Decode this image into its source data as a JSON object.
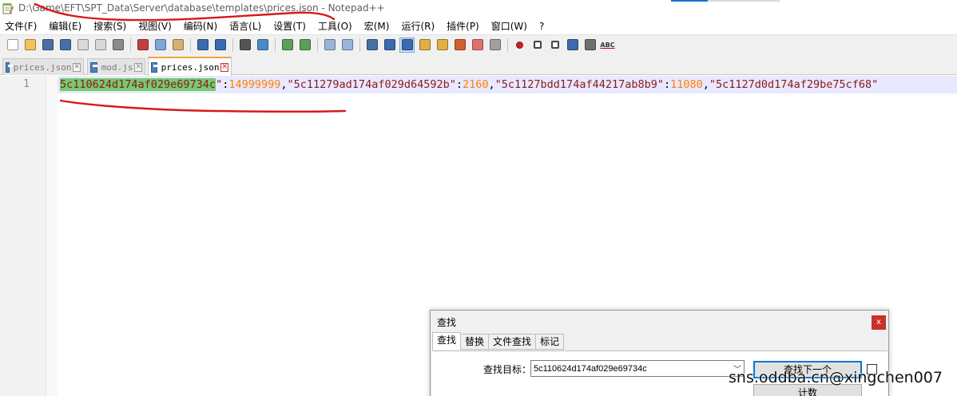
{
  "window": {
    "title": "D:\\Game\\EFT\\SPT_Data\\Server\\database\\templates\\prices.json - Notepad++",
    "app_icon": "notepad-icon"
  },
  "menu": [
    "文件(F)",
    "编辑(E)",
    "搜索(S)",
    "视图(V)",
    "编码(N)",
    "语言(L)",
    "设置(T)",
    "工具(O)",
    "宏(M)",
    "运行(R)",
    "插件(P)",
    "窗口(W)",
    "?"
  ],
  "toolbar": {
    "icons": [
      "new-file-icon",
      "open-file-icon",
      "save-icon",
      "save-all-icon",
      "close-icon",
      "close-all-icon",
      "print-icon",
      "cut-icon",
      "copy-icon",
      "paste-icon",
      "undo-icon",
      "redo-icon",
      "find-icon",
      "replace-icon",
      "zoom-in-icon",
      "zoom-out-icon",
      "sync-vertical-icon",
      "sync-horizontal-icon",
      "word-wrap-icon",
      "show-all-chars-icon",
      "indent-guide-icon",
      "udl-icon",
      "doc-map-icon",
      "function-list-icon",
      "folder-workspace-icon",
      "monitor-icon",
      "record-macro-icon",
      "stop-record-icon",
      "play-macro-icon",
      "run-macro-multiple-icon",
      "save-macro-icon",
      "spell-check-icon"
    ],
    "spellcheck_label": "ABC"
  },
  "tabs": [
    {
      "name": "prices.json",
      "active": false
    },
    {
      "name": "mod.js",
      "active": false
    },
    {
      "name": "prices.json",
      "active": true
    }
  ],
  "tab_close_glyph": "✕",
  "editor": {
    "line_number": "1",
    "tokens": [
      {
        "type": "sel",
        "text": "5c110624d174af029e69734c"
      },
      {
        "type": "str",
        "text": "\""
      },
      {
        "type": "pun",
        "text": ":"
      },
      {
        "type": "num",
        "text": "14999999"
      },
      {
        "type": "pun",
        "text": ","
      },
      {
        "type": "str",
        "text": "\"5c11279ad174af029d64592b\""
      },
      {
        "type": "pun",
        "text": ":"
      },
      {
        "type": "num",
        "text": "2160"
      },
      {
        "type": "pun",
        "text": ","
      },
      {
        "type": "str",
        "text": "\"5c1127bdd174af44217ab8b9\""
      },
      {
        "type": "pun",
        "text": ":"
      },
      {
        "type": "num",
        "text": "11080"
      },
      {
        "type": "pun",
        "text": ","
      },
      {
        "type": "str",
        "text": "\"5c1127d0d174af29be75cf68\""
      }
    ]
  },
  "find_dialog": {
    "title": "查找",
    "close_glyph": "x",
    "tabs": [
      "查找",
      "替换",
      "文件查找",
      "标记"
    ],
    "find_label": "查找目标：",
    "find_value": "5c110624d174af029e69734c",
    "find_next_button": "查找下一个",
    "count_button": "计数"
  },
  "watermark": "sns.oddba.cn@xingchen007",
  "colors": {
    "selection": "#76c96f",
    "string": "#8a1a1a",
    "number": "#ff8000",
    "current_line": "#e8e8ff",
    "annotation": "#d6191c",
    "active_tab_top": "#f3a339"
  }
}
